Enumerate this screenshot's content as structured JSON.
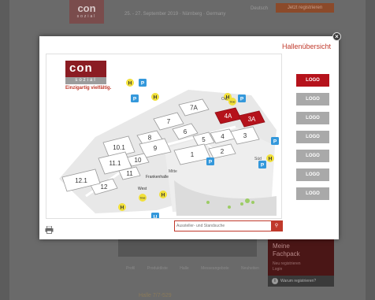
{
  "background": {
    "logo_text": "con",
    "logo_sub": "sozial",
    "date_text": "25. - 27. September 2019 · Nürnberg · Germany",
    "language": "Deutsch",
    "register_button": "Jetzt registrieren",
    "panel_line1": "Meine",
    "panel_line2": "Fachpack",
    "panel_link1": "Neu registrieren",
    "panel_link2": "Login",
    "info_text": "Warum registrieren?",
    "tabs": "Profil Produktliste Halle Messeangebote Neuheiten",
    "halle_label": "Halle 7/7-529"
  },
  "modal": {
    "title": "Hallenübersicht",
    "close_label": "×",
    "map_logo": "con",
    "map_logo_sub": "sozial",
    "map_slogan": "Einzigartig vielfältig.",
    "search_placeholder": "Aussteller- und Standsuche",
    "logo_label": "LOGO"
  },
  "halls": [
    {
      "label": "7A",
      "highlight": false
    },
    {
      "label": "7",
      "highlight": false
    },
    {
      "label": "6",
      "highlight": false
    },
    {
      "label": "5",
      "highlight": false
    },
    {
      "label": "4",
      "highlight": false
    },
    {
      "label": "4A",
      "highlight": true
    },
    {
      "label": "3A",
      "highlight": true
    },
    {
      "label": "3",
      "highlight": false
    },
    {
      "label": "2",
      "highlight": false
    },
    {
      "label": "1",
      "highlight": false
    },
    {
      "label": "8",
      "highlight": false
    },
    {
      "label": "9",
      "highlight": false
    },
    {
      "label": "10",
      "highlight": false
    },
    {
      "label": "10.1",
      "highlight": false
    },
    {
      "label": "11",
      "highlight": false
    },
    {
      "label": "11.1",
      "highlight": false
    },
    {
      "label": "12",
      "highlight": false
    },
    {
      "label": "12.1",
      "highlight": false
    }
  ],
  "map_labels": {
    "ost": "Ost",
    "sued": "Süd",
    "mitte": "Mitte",
    "frankenhalle": "Frankenhalle",
    "west": "West",
    "taxi": "TAXI"
  },
  "colors": {
    "accent": "#c0392b",
    "highlight_hall": "#b5121b",
    "parking": "#3498db",
    "bus": "#f1e03a"
  }
}
